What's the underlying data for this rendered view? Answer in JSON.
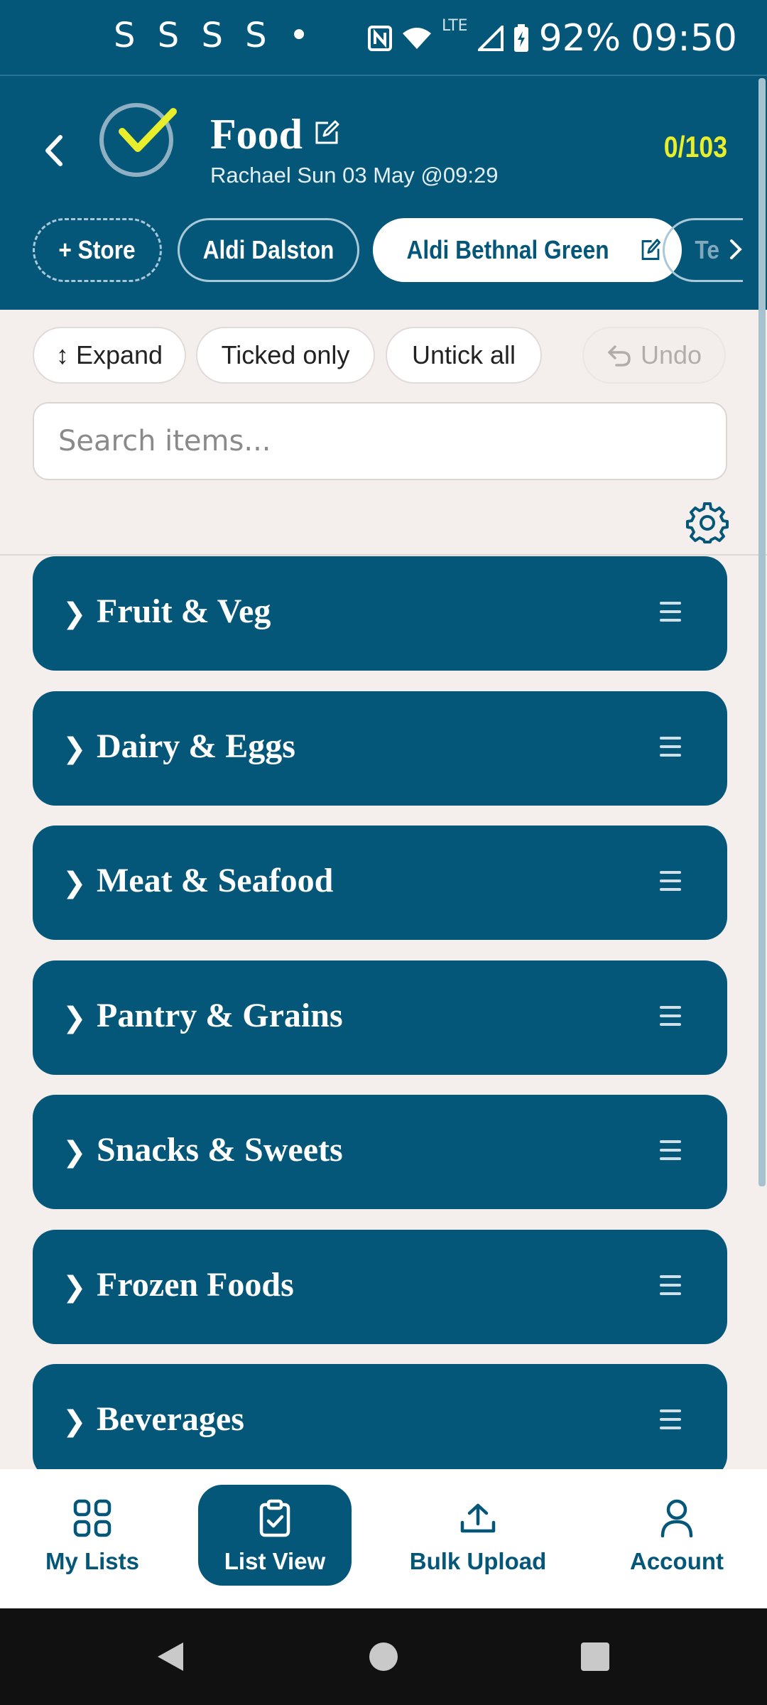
{
  "status_bar": {
    "left_indicators": "S S S S •",
    "network": "LTE",
    "battery": "92%",
    "time": "09:50"
  },
  "header": {
    "title": "Food",
    "subtitle": "Rachael Sun 03 May @09:29",
    "count": "0/103"
  },
  "stores": {
    "add_label": "+ Store",
    "items": [
      {
        "label": "Aldi Dalston"
      },
      {
        "label": "Aldi Bethnal Green"
      },
      {
        "label": "Te"
      }
    ]
  },
  "toolbar": {
    "expand_label": "↕ Expand",
    "ticked_label": "Ticked only",
    "untick_label": "Untick all",
    "undo_label": "Undo"
  },
  "search": {
    "placeholder": "Search items..."
  },
  "categories": [
    {
      "name": "Fruit & Veg"
    },
    {
      "name": "Dairy & Eggs"
    },
    {
      "name": "Meat & Seafood"
    },
    {
      "name": "Pantry & Grains"
    },
    {
      "name": "Snacks & Sweets"
    },
    {
      "name": "Frozen Foods"
    },
    {
      "name": "Beverages"
    }
  ],
  "bottom_nav": {
    "my_lists": "My Lists",
    "list_view": "List View",
    "bulk_upload": "Bulk Upload",
    "account": "Account"
  },
  "colors": {
    "primary": "#05577a",
    "accent_yellow": "#e8ee2b",
    "background": "#f4efec"
  }
}
